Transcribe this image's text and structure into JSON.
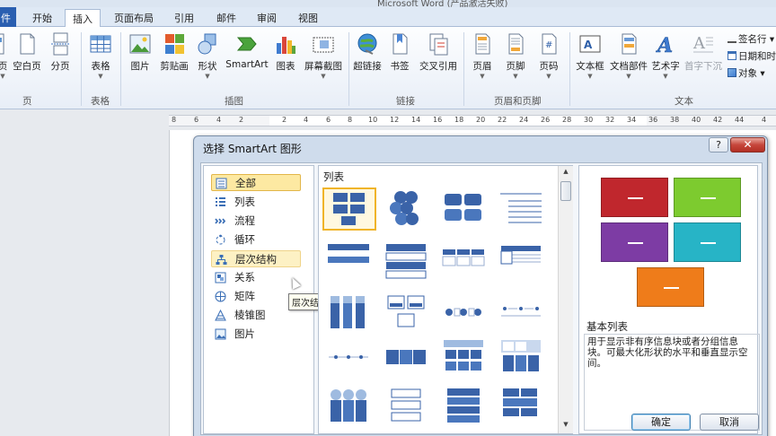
{
  "window": {
    "title": "Microsoft Word (产品激活失败)"
  },
  "tabs": [
    {
      "label": "件"
    },
    {
      "label": "开始"
    },
    {
      "label": "插入"
    },
    {
      "label": "页面布局"
    },
    {
      "label": "引用"
    },
    {
      "label": "邮件"
    },
    {
      "label": "审阅"
    },
    {
      "label": "视图"
    }
  ],
  "ribbon": {
    "buttons": [
      {
        "label": "页",
        "icon": "cover-page-icon"
      },
      {
        "label": "空白页",
        "icon": "blank-page-icon"
      },
      {
        "label": "分页",
        "icon": "page-break-icon"
      },
      {
        "label": "表格",
        "icon": "table-icon"
      },
      {
        "label": "图片",
        "icon": "picture-icon"
      },
      {
        "label": "剪贴画",
        "icon": "clipart-icon"
      },
      {
        "label": "形状",
        "icon": "shapes-icon"
      },
      {
        "label": "SmartArt",
        "icon": "smartart-icon"
      },
      {
        "label": "图表",
        "icon": "chart-icon"
      },
      {
        "label": "屏幕截图",
        "icon": "screenshot-icon"
      },
      {
        "label": "超链接",
        "icon": "hyperlink-icon"
      },
      {
        "label": "书签",
        "icon": "bookmark-icon"
      },
      {
        "label": "交叉引用",
        "icon": "cross-reference-icon"
      },
      {
        "label": "页眉",
        "icon": "header-icon"
      },
      {
        "label": "页脚",
        "icon": "footer-icon"
      },
      {
        "label": "页码",
        "icon": "page-number-icon"
      },
      {
        "label": "文本框",
        "icon": "textbox-icon"
      },
      {
        "label": "文档部件",
        "icon": "quick-parts-icon"
      },
      {
        "label": "艺术字",
        "icon": "wordart-icon"
      },
      {
        "label": "首字下沉",
        "icon": "dropcap-icon"
      }
    ],
    "small_buttons": [
      {
        "label": "签名行 ▾"
      },
      {
        "label": "日期和时"
      },
      {
        "label": "对象 ▾"
      }
    ],
    "groups": [
      {
        "label": "页"
      },
      {
        "label": "表格"
      },
      {
        "label": "插图"
      },
      {
        "label": "链接"
      },
      {
        "label": "页眉和页脚"
      },
      {
        "label": "文本"
      }
    ]
  },
  "ruler": {
    "ticks": [
      "8",
      "6",
      "4",
      "2",
      "2",
      "4",
      "6",
      "8",
      "10",
      "12",
      "14",
      "16",
      "18",
      "20",
      "22",
      "24",
      "26",
      "28",
      "30",
      "32",
      "34",
      "36",
      "38",
      "40",
      "42",
      "44",
      "4"
    ]
  },
  "dialog": {
    "title": "选择 SmartArt 图形",
    "help_label": "?",
    "close_label": "✕",
    "categories": [
      {
        "label": "全部",
        "icon": "all-icon"
      },
      {
        "label": "列表",
        "icon": "list-icon"
      },
      {
        "label": "流程",
        "icon": "process-icon"
      },
      {
        "label": "循环",
        "icon": "cycle-icon"
      },
      {
        "label": "层次结构",
        "icon": "hierarchy-icon"
      },
      {
        "label": "关系",
        "icon": "relationship-icon"
      },
      {
        "label": "矩阵",
        "icon": "matrix-icon"
      },
      {
        "label": "棱锥图",
        "icon": "pyramid-icon"
      },
      {
        "label": "图片",
        "icon": "picture-icon"
      }
    ],
    "selected_category": "全部",
    "tooltip": "层次结构",
    "gallery_header": "列表",
    "preview": {
      "name": "基本列表",
      "description": "用于显示非有序信息块或者分组信息块。可最大化形状的水平和垂直显示空间。",
      "box_colors": [
        "#c0272d",
        "#7dcb2f",
        "#7d3ca4",
        "#27b4c6",
        "#ef7c1a"
      ]
    },
    "ok_label": "确定",
    "cancel_label": "取消"
  }
}
